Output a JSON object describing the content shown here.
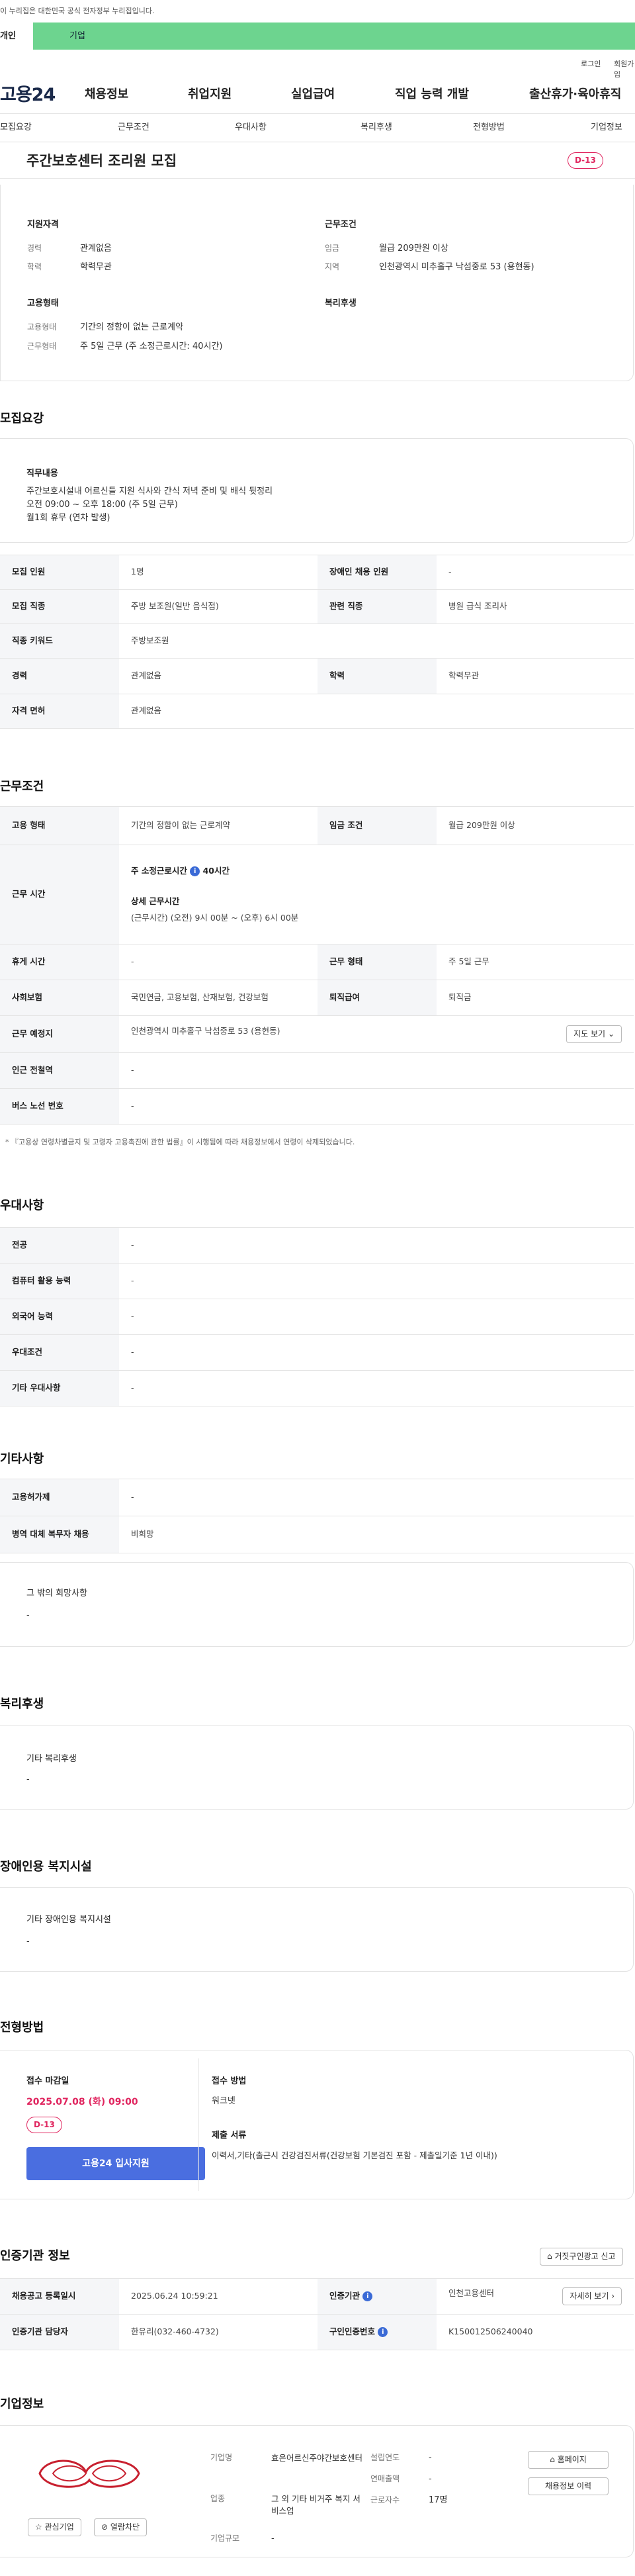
{
  "gov_notice": "이 누리집은 대한민국 공식 전자정부 누리집입니다.",
  "top_tabs": [
    "개인",
    "기업"
  ],
  "util": {
    "login": "로그인",
    "join": "회원가입"
  },
  "logo": "고용24",
  "gnb": [
    "채용정보",
    "취업지원",
    "실업급여",
    "직업 능력 개발",
    "출산휴가·육아휴직"
  ],
  "anchors": [
    "모집요강",
    "근무조건",
    "우대사항",
    "복리후생",
    "전형방법",
    "기업정보"
  ],
  "title": "주간보호센터 조리원 모집",
  "dday": "D-13",
  "summary": {
    "qual_title": "지원자격",
    "career_k": "경력",
    "career_v": "관계없음",
    "edu_k": "학력",
    "edu_v": "학력무관",
    "cond_title": "근무조건",
    "wage_k": "임금",
    "wage_v": "월급 209만원 이상",
    "region_k": "지역",
    "region_v": "인천광역시 미추홀구 낙섬중로 53 (용현동)",
    "emp_title": "고용형태",
    "emp_k": "고용형태",
    "emp_v": "기간의 정함이 없는 근로계약",
    "work_k": "근무형태",
    "work_v": "주 5일 근무 (주 소정근로시간: 40시간)",
    "welfare_title": "복리후생"
  },
  "recruit": {
    "title": "모집요강",
    "duty_h": "직무내용",
    "duty_v": "주간보호시설내 어르신들 지원 식사와 간식 저녁 준비 및  배식 뒷정리\n오전 09:00 ~ 오후 18:00 (주 5일 근무)\n월1회 휴무 (연차 발생)",
    "rows": [
      {
        "k1": "모집 인원",
        "v1": "1명",
        "k2": "장애인 채용 인원",
        "v2": "-"
      },
      {
        "k1": "모집 직종",
        "v1": "주방 보조원(일반 음식점)",
        "k2": "관련 직종",
        "v2": "병원 급식 조리사"
      },
      {
        "k1": "직종 키워드",
        "v1": "주방보조원"
      },
      {
        "k1": "경력",
        "v1": "관계없음",
        "k2": "학력",
        "v2": "학력무관"
      },
      {
        "k1": "자격 면허",
        "v1": "관계없음"
      }
    ]
  },
  "cond": {
    "title": "근무조건",
    "emp_k": "고용 형태",
    "emp_v": "기간의 정함이 없는 근로계약",
    "wage_k": "임금 조건",
    "wage_v": "월급 209만원 이상",
    "time_k": "근무 시간",
    "time_weekly": "주 소정근로시간",
    "time_weekly_v": "40시간",
    "time_detail_h": "상세 근무시간",
    "time_detail_v": "(근무시간) (오전) 9시 00분 ~ (오후) 6시 00분",
    "rest_k": "휴게 시간",
    "rest_v": "-",
    "form_k": "근무 형태",
    "form_v": "주 5일 근무",
    "ins_k": "사회보험",
    "ins_v": "국민연금, 고용보험, 산재보험, 건강보험",
    "sev_k": "퇴직급여",
    "sev_v": "퇴직금",
    "place_k": "근무 예정지",
    "place_v": "인천광역시 미추홀구 낙섬중로 53 (용현동)",
    "map_btn": "지도 보기",
    "subway_k": "인근 전철역",
    "subway_v": "-",
    "bus_k": "버스 노선 번호",
    "bus_v": "-",
    "note": "* 『고용상 연령차별금지 및 고령자 고용촉진에 관한 법률』이 시행됨에 따라 채용정보에서 연령이 삭제되었습니다."
  },
  "pref": {
    "title": "우대사항",
    "rows": [
      {
        "k": "전공",
        "v": "-"
      },
      {
        "k": "컴퓨터 활용 능력",
        "v": "-"
      },
      {
        "k": "외국어 능력",
        "v": "-"
      },
      {
        "k": "우대조건",
        "v": "-"
      },
      {
        "k": "기타 우대사항",
        "v": "-"
      }
    ]
  },
  "etc": {
    "title": "기타사항",
    "rows": [
      {
        "k": "고용허가제",
        "v": "-"
      },
      {
        "k": "병역 대체 복무자 채용",
        "v": "비희망"
      }
    ],
    "hope_h": "그 밖의 희망사항",
    "hope_v": "-"
  },
  "welfare": {
    "title": "복리후생",
    "h": "기타 복리후생",
    "v": "-"
  },
  "disabled": {
    "title": "장애인용 복지시설",
    "h": "기타 장애인용 복지시설",
    "v": "-"
  },
  "process": {
    "title": "전형방법",
    "deadline_h": "접수 마감일",
    "deadline_v": "2025.07.08 (화) 09:00",
    "dday": "D-13",
    "apply": "고용24 입사지원",
    "method_h": "접수 방법",
    "method_v": "워크넷",
    "docs_h": "제출 서류",
    "docs_v": "이력서,기타(출근시 건강검진서류(건강보험 기본검진 포함 - 제출일기준 1년 이내))"
  },
  "agency": {
    "title": "인증기관 정보",
    "report_btn": "거짓구인광고 신고",
    "reg_k": "채용공고 등록일시",
    "reg_v": "2025.06.24 10:59:21",
    "org_k": "인증기관",
    "org_v": "인천고용센터",
    "detail_btn": "자세히 보기",
    "mgr_k": "인증기관 담당자",
    "mgr_v": "한유리(032-460-4732)",
    "no_k": "구인인증번호",
    "no_v": "K150012506240040"
  },
  "company": {
    "title": "기업정보",
    "fav_btn": "관심기업",
    "block_btn": "열람차단",
    "name_k": "기업명",
    "name_v": "효은어르신주야간보호센터",
    "ind_k": "업종",
    "ind_v": "그 외 기타 비거주 복지 서비스업",
    "scale_k": "기업규모",
    "scale_v": "-",
    "found_k": "설립연도",
    "found_v": "-",
    "sales_k": "연매출액",
    "sales_v": "-",
    "emp_k": "근로자수",
    "emp_v": "17명",
    "home_btn": "홈페이지",
    "history_btn": "채용정보 이력"
  }
}
